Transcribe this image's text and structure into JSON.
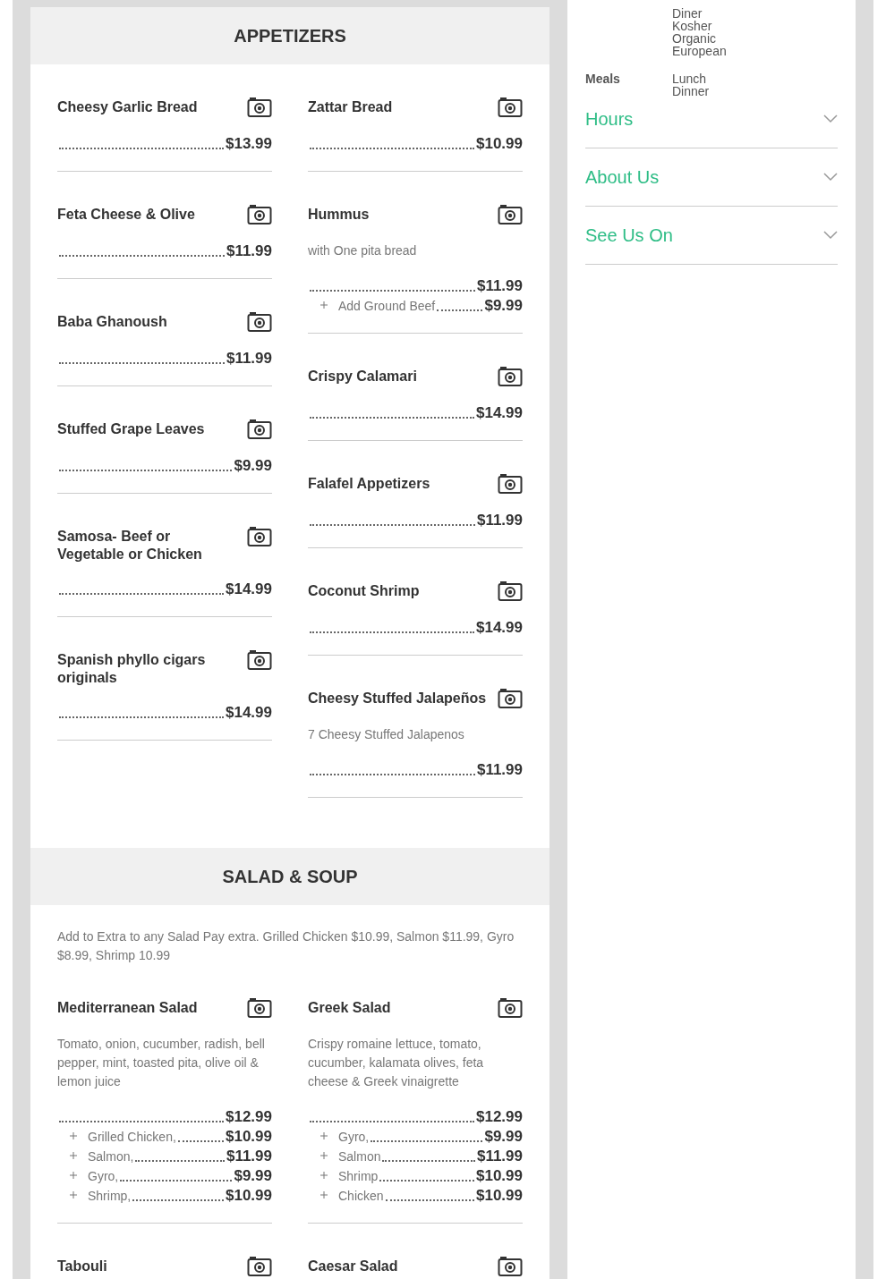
{
  "menu": {
    "sections": [
      {
        "title": "APPETIZERS",
        "columns": [
          [
            {
              "name": "Cheesy Garlic Bread",
              "price": "$13.99"
            },
            {
              "name": "Feta Cheese & Olive",
              "price": "$11.99"
            },
            {
              "name": "Baba Ghanoush",
              "price": "$11.99"
            },
            {
              "name": "Stuffed Grape Leaves",
              "price": "$9.99"
            },
            {
              "name": "Samosa- Beef or Vegetable or Chicken",
              "price": "$14.99"
            },
            {
              "name": "Spanish phyllo cigars originals",
              "price": "$14.99"
            }
          ],
          [
            {
              "name": "Zattar Bread",
              "price": "$10.99"
            },
            {
              "name": "Hummus",
              "description": "with One pita bread",
              "price": "$11.99",
              "options": [
                {
                  "label": "Add Ground Beef",
                  "price": "$9.99"
                }
              ]
            },
            {
              "name": "Crispy Calamari",
              "price": "$14.99"
            },
            {
              "name": "Falafel Appetizers",
              "price": "$11.99"
            },
            {
              "name": "Coconut Shrimp",
              "price": "$14.99"
            },
            {
              "name": "Cheesy Stuffed Jalapeños",
              "description": "7 Cheesy Stuffed Jalapenos",
              "price": "$11.99"
            }
          ]
        ]
      },
      {
        "title": "SALAD & SOUP",
        "note": "Add to Extra to any Salad Pay extra. Grilled Chicken $10.99, Salmon $11.99, Gyro $8.99, Shrimp 10.99",
        "columns": [
          [
            {
              "name": "Mediterranean Salad",
              "description": "Tomato, onion, cucumber, radish, bell pepper, mint, toasted pita, olive oil & lemon juice",
              "price": "$12.99",
              "options": [
                {
                  "label": "Grilled Chicken,",
                  "price": "$10.99"
                },
                {
                  "label": "Salmon,",
                  "price": "$11.99"
                },
                {
                  "label": "Gyro,",
                  "price": "$9.99"
                },
                {
                  "label": "Shrimp,",
                  "price": "$10.99"
                }
              ]
            },
            {
              "name": "Tabouli"
            }
          ],
          [
            {
              "name": "Greek Salad",
              "description": "Crispy romaine lettuce, tomato, cucumber, kalamata olives, feta cheese & Greek vinaigrette",
              "price": "$12.99",
              "options": [
                {
                  "label": "Gyro,",
                  "price": "$9.99"
                },
                {
                  "label": "Salmon",
                  "price": "$11.99"
                },
                {
                  "label": "Shrimp",
                  "price": "$10.99"
                },
                {
                  "label": "Chicken",
                  "price": "$10.99"
                }
              ]
            },
            {
              "name": "Caesar Salad"
            }
          ]
        ]
      }
    ]
  },
  "sidebar": {
    "details": [
      {
        "values": [
          "Diner",
          "Kosher",
          "Organic",
          "European"
        ]
      },
      {
        "label": "Meals",
        "values": [
          "Lunch",
          "Dinner"
        ]
      }
    ],
    "accordions": [
      {
        "title": "Hours",
        "expanded": false
      },
      {
        "title": "About Us",
        "expanded": false
      },
      {
        "title": "See Us On",
        "expanded": false
      }
    ]
  }
}
